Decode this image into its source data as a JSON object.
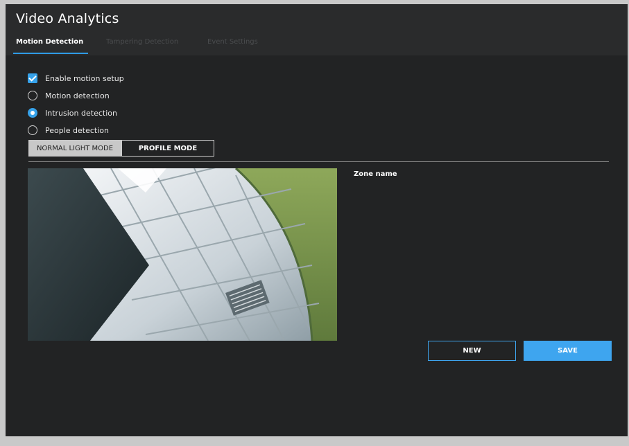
{
  "header": {
    "title": "Video Analytics",
    "tabs": [
      {
        "label": "Motion Detection",
        "active": true
      },
      {
        "label": "Tampering Detection",
        "active": false
      },
      {
        "label": "Event Settings",
        "active": false
      }
    ]
  },
  "options": {
    "enable_motion_setup": {
      "label": "Enable motion setup",
      "checked": true
    },
    "motion_detection": {
      "label": "Motion detection",
      "checked": false
    },
    "intrusion_detection": {
      "label": "Intrusion detection",
      "checked": true
    },
    "people_detection": {
      "label": "People detection",
      "checked": false
    }
  },
  "modes": {
    "normal_light": "NORMAL LIGHT MODE",
    "profile": "PROFILE MODE"
  },
  "zone": {
    "label": "Zone name"
  },
  "actions": {
    "new_label": "NEW",
    "save_label": "SAVE"
  },
  "colors": {
    "accent": "#3ea5ef",
    "background": "#222324",
    "header": "#2a2b2c"
  }
}
